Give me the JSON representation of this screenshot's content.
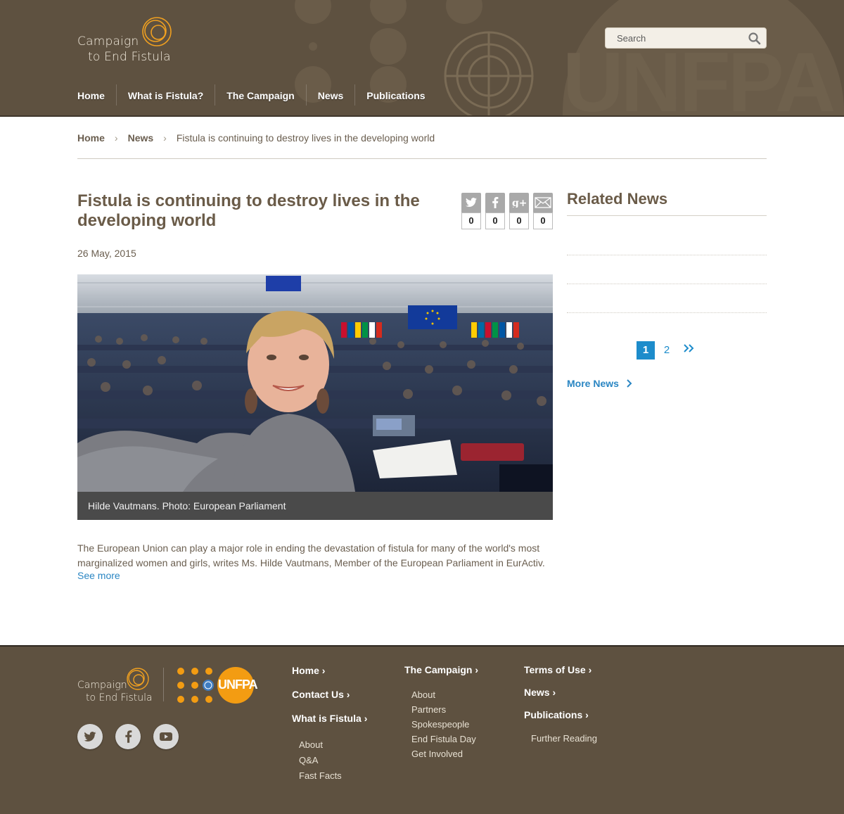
{
  "header": {
    "logo_line1": "Campaign",
    "logo_line2": "to End Fistula",
    "search_placeholder": "Search",
    "nav": [
      "Home",
      "What is Fistula?",
      "The Campaign",
      "News",
      "Publications"
    ],
    "bg_color": "#5e5140"
  },
  "breadcrumb": {
    "home": "Home",
    "news": "News",
    "current": "Fistula is continuing to destroy lives in the developing world"
  },
  "article": {
    "title": "Fistula is continuing to destroy lives in the developing world",
    "date": "26 May, 2015",
    "caption": "Hilde Vautmans. Photo: European Parliament",
    "body": "The European Union can play a major role in ending the devastation of fistula for many of the world's most marginalized women and girls, writes Ms. Hilde Vautmans, Member of the European Parliament in EurActiv.",
    "see_more": "See more",
    "share": [
      {
        "icon": "twitter-icon",
        "count": "0"
      },
      {
        "icon": "facebook-icon",
        "count": "0"
      },
      {
        "icon": "google-plus-icon",
        "count": "0"
      },
      {
        "icon": "email-icon",
        "count": "0"
      }
    ]
  },
  "sidebar": {
    "title": "Related News",
    "pages": [
      "1",
      "2"
    ],
    "next": "»",
    "more_news": "More News"
  },
  "footer": {
    "logo_line1": "Campaign",
    "logo_line2": "to End Fistula",
    "unfpa": "UNFPA",
    "social": [
      "twitter-icon",
      "facebook-icon",
      "youtube-icon"
    ],
    "col1": {
      "home": "Home",
      "contact": "Contact Us",
      "what_is": "What is Fistula",
      "items": [
        "About",
        "Q&A",
        "Fast Facts"
      ]
    },
    "col2": {
      "campaign": "The Campaign",
      "items": [
        "About",
        "Partners",
        "Spokespeople",
        "End Fistula Day",
        "Get Involved"
      ]
    },
    "col3": {
      "terms": "Terms of Use",
      "news": "News",
      "publications": "Publications",
      "items": [
        "Further Reading"
      ]
    }
  },
  "colors": {
    "brown": "#5e5140",
    "accent_orange": "#f0a020",
    "link_blue": "#2a86c3",
    "pager_blue": "#1d8ccb"
  }
}
